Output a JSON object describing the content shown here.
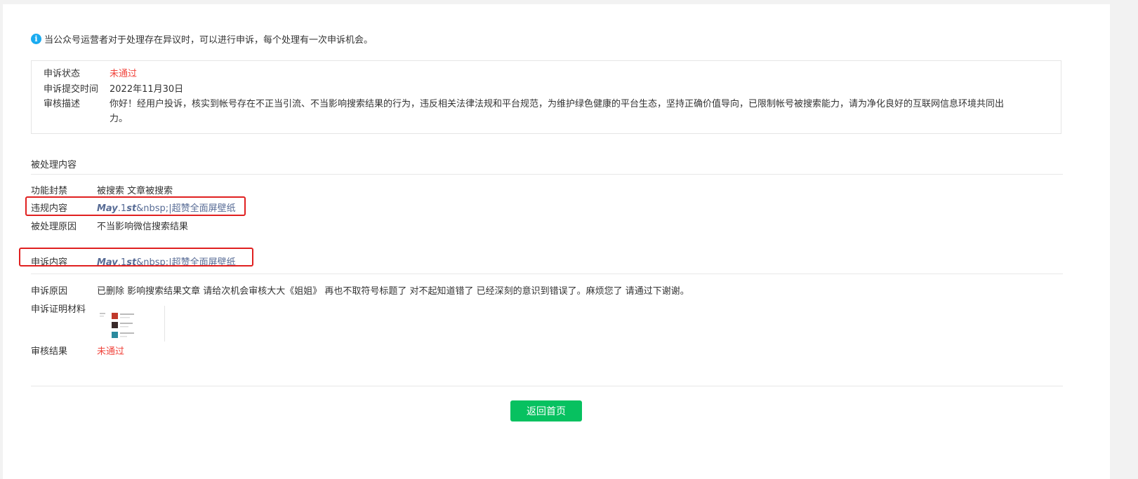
{
  "notice": {
    "icon": "info-icon",
    "text": "当公众号运营者对于处理存在异议时，可以进行申诉，每个处理有一次申诉机会。"
  },
  "status": {
    "state_label": "申诉状态",
    "state_value": "未通过",
    "submit_label": "申诉提交时间",
    "submit_value": "2022年11月30日",
    "review_label": "审核描述",
    "review_line1": "你好！经用户投诉，核实到帐号存在不正当引流、不当影响搜索结果的行为，违反相关法律法规和平台规范，为维护绿色健康的平台生态，坚持正确价值导向，已限制帐号被搜索能力，请为净化良好的互联网信息环境共同出",
    "review_line2": "力。"
  },
  "processed": {
    "title": "被处理内容",
    "ban_label": "功能封禁",
    "ban_value": "被搜索 文章被搜索",
    "violation_label": "违规内容",
    "violation_may": "May",
    "violation_mid": ".1",
    "violation_st": "st",
    "violation_rest": "&nbsp;|超赞全面屏壁纸",
    "reason_label": "被处理原因",
    "reason_value": "不当影响微信搜索结果"
  },
  "appeal": {
    "content_label": "申诉内容",
    "content_may": "May",
    "content_mid": ".1",
    "content_st": "st",
    "content_rest": "&nbsp;|超赞全面屏壁纸",
    "reason_label": "申诉原因",
    "reason_value": "已删除 影响搜索结果文章 请给次机会审核大大《姐姐》 再也不取符号标题了 对不起知道错了  已经深刻的意识到错误了。麻烦您了 请通过下谢谢。",
    "evidence_label": "申诉证明材料",
    "result_label": "审核结果",
    "result_value": "未通过"
  },
  "footer": {
    "back_button": "返回首页"
  },
  "colors": {
    "accent_green": "#07c160",
    "status_red": "#f0443c",
    "link_blue": "#576b95",
    "annotation_red": "#e02020"
  }
}
